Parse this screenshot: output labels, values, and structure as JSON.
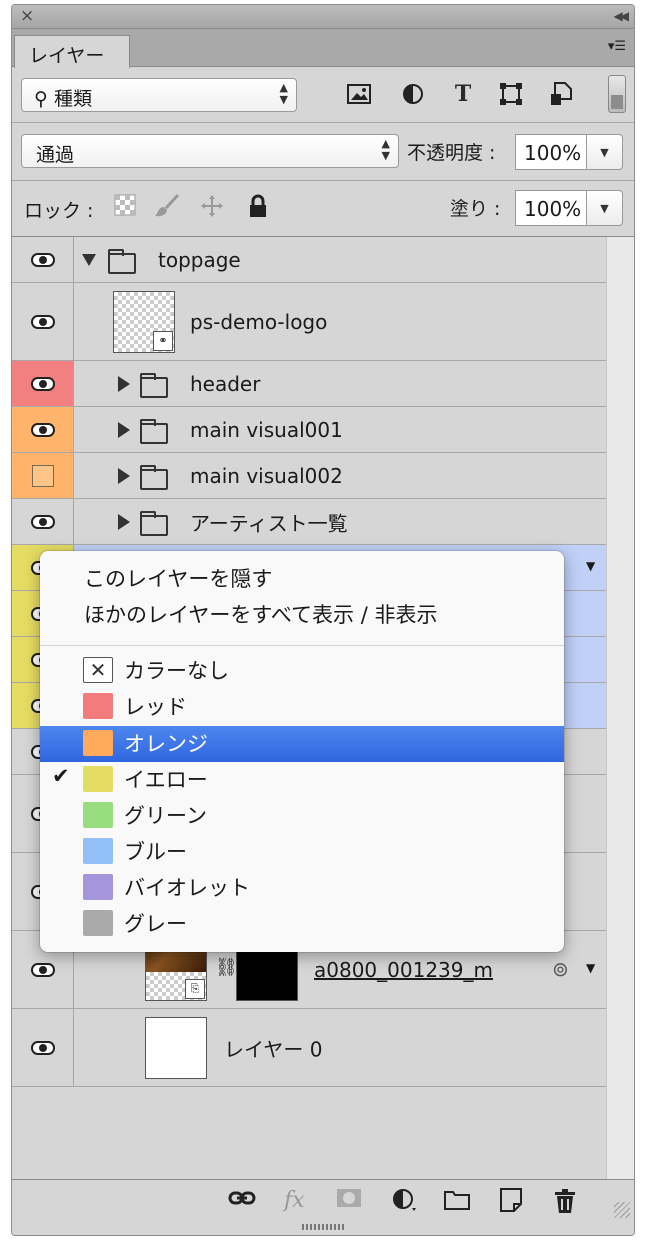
{
  "panel": {
    "tab_label": "レイヤー"
  },
  "filter": {
    "kind_label": "種類"
  },
  "blend": {
    "mode": "通過",
    "opacity_label": "不透明度 :",
    "opacity_value": "100%"
  },
  "lock": {
    "label": "ロック :",
    "fill_label": "塗り :",
    "fill_value": "100%"
  },
  "layers": [
    {
      "name": "toppage"
    },
    {
      "name": "ps-demo-logo"
    },
    {
      "name": "header",
      "color": "#f28080"
    },
    {
      "name": "main visual001",
      "color": "#ffb36b"
    },
    {
      "name": "main visual002",
      "color": "#ffb36b"
    },
    {
      "name": "アーティスト一覧"
    },
    {
      "name": "a0800_001239_m"
    },
    {
      "name": "レイヤー 0"
    }
  ],
  "context_menu": {
    "hide_layer": "このレイヤーを隠す",
    "toggle_others": "ほかのレイヤーをすべて表示 / 非表示",
    "colors": [
      {
        "label": "カラーなし",
        "swatch": "none"
      },
      {
        "label": "レッド",
        "swatch": "#f47b7b"
      },
      {
        "label": "オレンジ",
        "swatch": "#ffa95a",
        "highlighted": true
      },
      {
        "label": "イエロー",
        "swatch": "#e5dc63",
        "checked": true
      },
      {
        "label": "グリーン",
        "swatch": "#98dc80"
      },
      {
        "label": "ブルー",
        "swatch": "#93c1f7"
      },
      {
        "label": "バイオレット",
        "swatch": "#a595dc"
      },
      {
        "label": "グレー",
        "swatch": "#aaaaaa"
      }
    ]
  },
  "colors": {
    "panel_bg": "#d6d6d6",
    "selection": "#c0d0f7",
    "menu_highlight": "#3670e6"
  }
}
